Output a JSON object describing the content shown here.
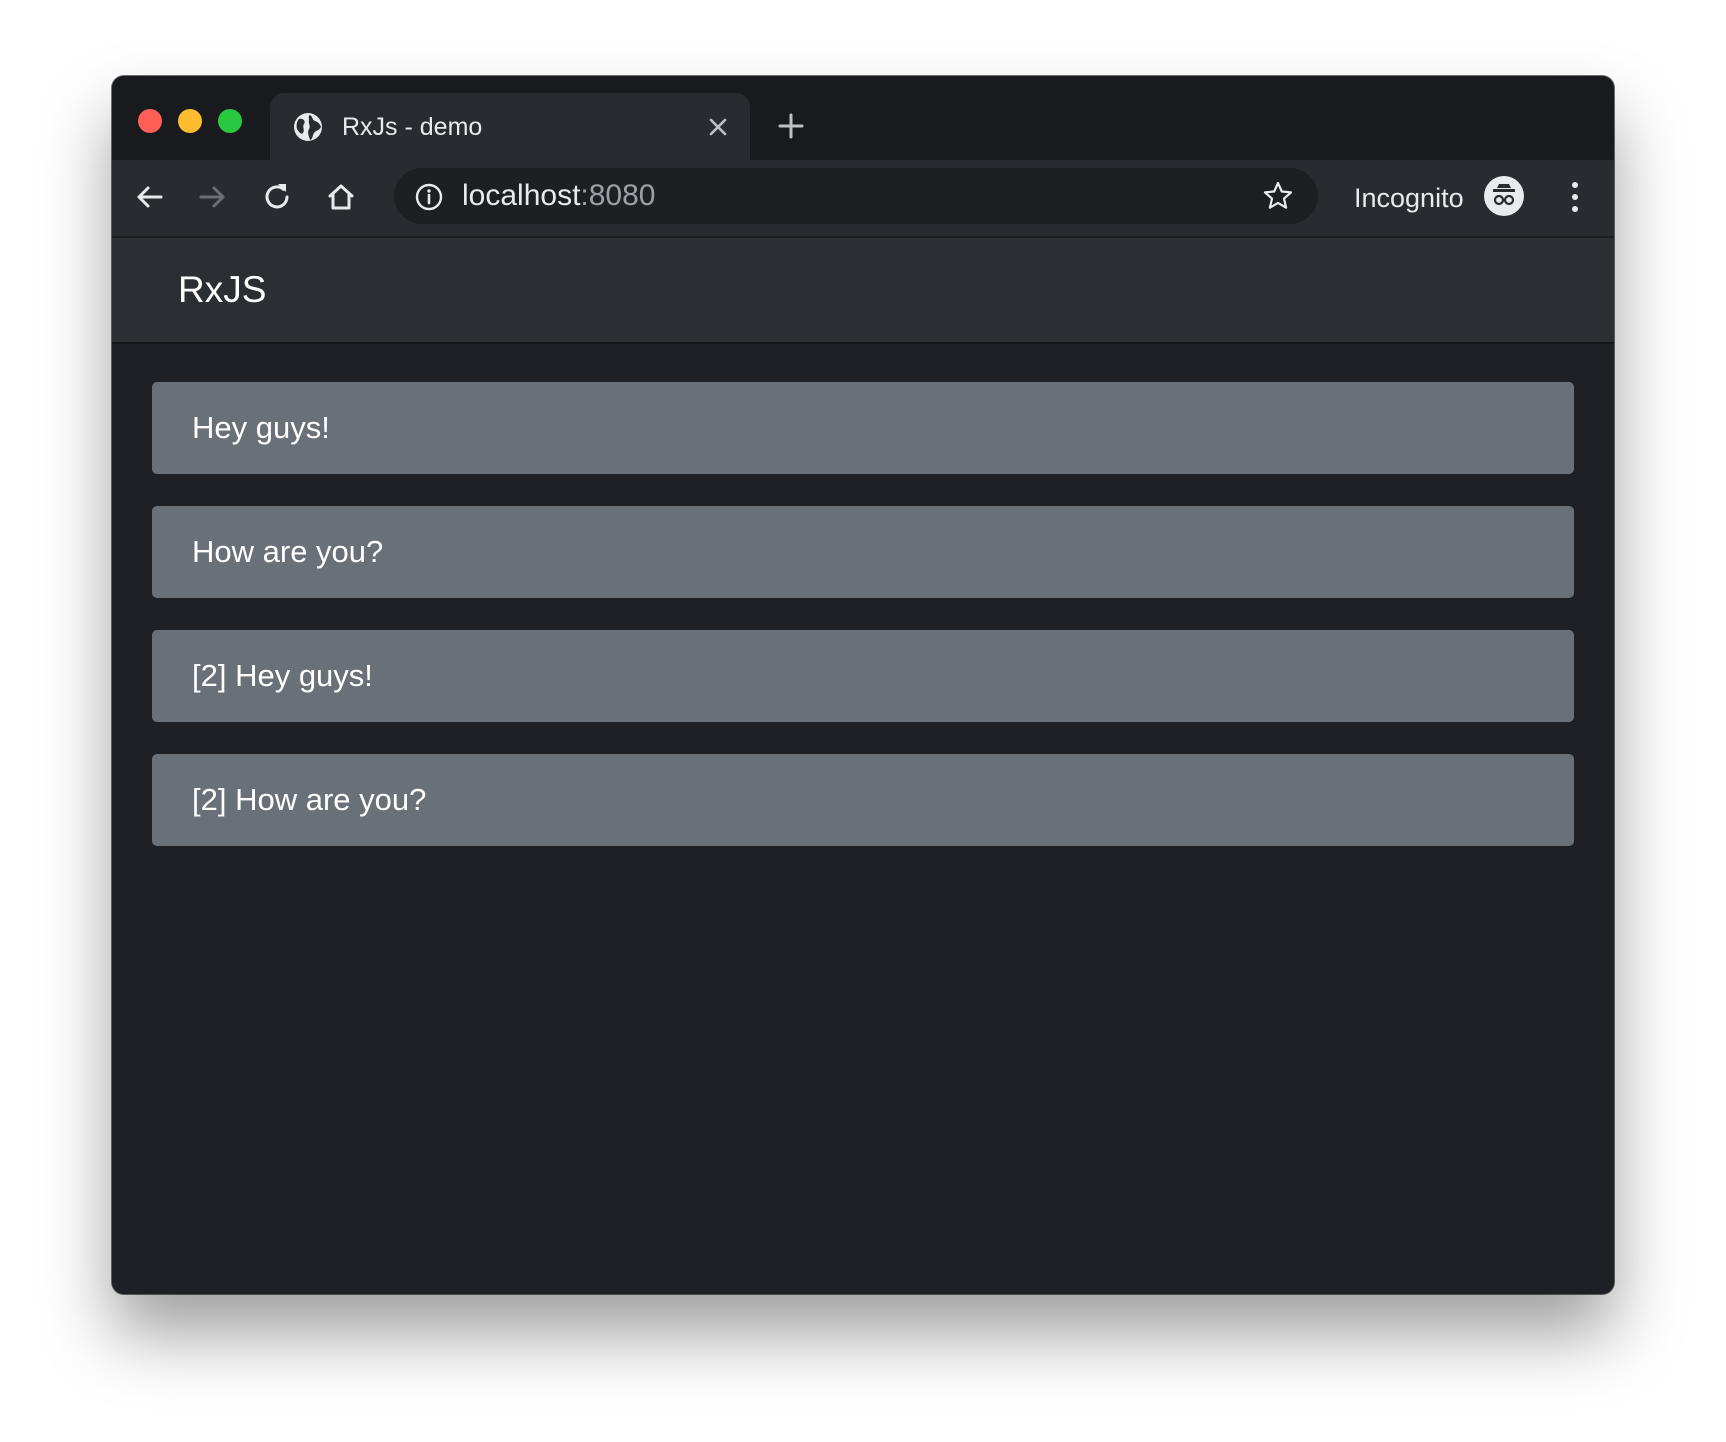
{
  "browser": {
    "tab": {
      "title": "RxJs - demo"
    },
    "address": {
      "host": "localhost",
      "port": ":8080"
    },
    "profile_label": "Incognito"
  },
  "app": {
    "brand": "RxJS",
    "messages": [
      {
        "text": "Hey guys!"
      },
      {
        "text": "How are you?"
      },
      {
        "text": "[2] Hey guys!"
      },
      {
        "text": "[2] How are you?"
      }
    ]
  }
}
